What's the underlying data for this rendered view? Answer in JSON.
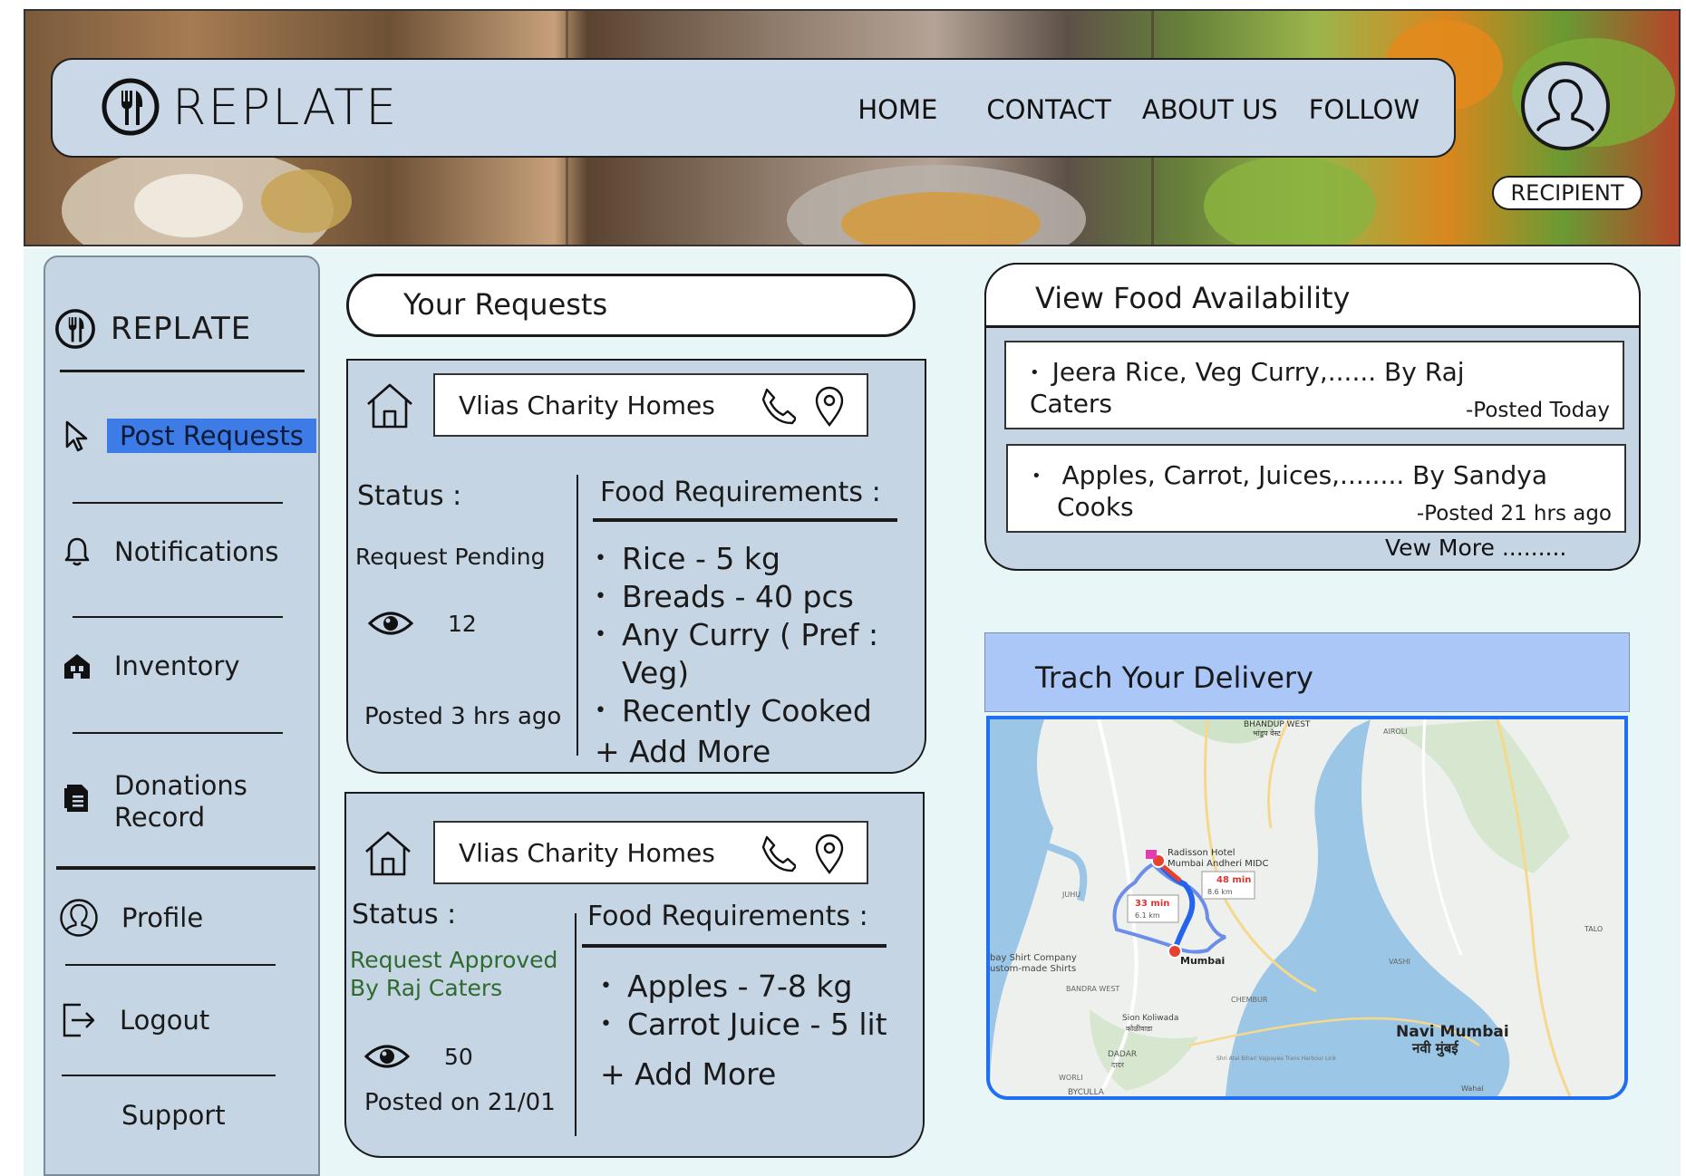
{
  "brand": {
    "name": "REPLATE"
  },
  "nav": {
    "home": "HOME",
    "contact": "CONTACT",
    "about": "ABOUT US",
    "follow": "FOLLOW"
  },
  "user": {
    "role": "RECIPIENT"
  },
  "sidebar": {
    "brand": "REPLATE",
    "items": [
      {
        "label": "Post Requests",
        "icon": "cursor-icon",
        "active": true
      },
      {
        "label": "Notifications",
        "icon": "bell-icon"
      },
      {
        "label": "Inventory",
        "icon": "store-icon"
      },
      {
        "label": "Donations",
        "label2": "Record",
        "icon": "document-icon"
      },
      {
        "label": "Profile",
        "icon": "user-circle-icon"
      },
      {
        "label": "Logout",
        "icon": "logout-icon"
      },
      {
        "label": "Support"
      }
    ]
  },
  "requests": {
    "title": "Your Requests",
    "cards": [
      {
        "org": "Vlias Charity Homes",
        "status_label": "Status :",
        "status": "Request Pending",
        "status_color": "#1a1a1a",
        "views": "12",
        "posted": "Posted 3 hrs ago",
        "food_title": "Food Requirements :",
        "items": [
          "Rice -  5 kg",
          "Breads - 40 pcs",
          "Any Curry ( Pref : Veg)",
          "Recently Cooked"
        ],
        "add_more": "+ Add More"
      },
      {
        "org": "Vlias Charity Homes",
        "status_label": "Status :",
        "status": "Request Approved",
        "status2": "By Raj Caters",
        "status_color": "#2f6b2f",
        "views": "50",
        "posted": "Posted on 21/01",
        "food_title": "Food Requirements :",
        "items": [
          "Apples - 7-8 kg",
          "Carrot Juice - 5 lit"
        ],
        "add_more": "+ Add More"
      }
    ]
  },
  "availability": {
    "title": "View Food Availability",
    "items": [
      {
        "text": "Jeera Rice, Veg Curry,...... By Raj Caters",
        "posted": "-Posted  Today"
      },
      {
        "text": "Apples, Carrot, Juices,........  By Sandya",
        "text2": "Cooks",
        "posted": "-Posted  21 hrs ago"
      }
    ],
    "view_more": "Vew More ........."
  },
  "delivery": {
    "title": "Trach Your Delivery",
    "map": {
      "labels": {
        "bhandup": "BHANDUP WEST",
        "bhandup_local": "भांडुप वेस्ट",
        "hotel1": "Radisson Hotel",
        "hotel2": "Mumbai Andheri MIDC",
        "route1_time": "33 min",
        "route1_dist": "6.1 km",
        "route2_time": "48 min",
        "route2_dist": "8.6 km",
        "mumbai": "Mumbai",
        "shirt1": "bay Shirt Company",
        "shirt2": "ustom-made Shirts",
        "bandra": "BANDRA WEST",
        "sion": "Sion Koliwada",
        "sion_local": "कोळीवाडा",
        "chembur": "CHEMBUR",
        "vashi": "VASHI",
        "navi1": "Navi Mumbai",
        "navi2": "नवी मुंबई",
        "dadar": "DADAR",
        "dadar_local": "दादर",
        "worli": "WORLI",
        "byculla": "BYCULLA",
        "talo": "TALO",
        "wadi": "Wahal",
        "airoli": "AIROLI",
        "juhu": "JUHU",
        "bridge": "Shri Atal Bihari Vajpayee Trans Harbour Link"
      },
      "colors": {
        "route": "#2563eb",
        "route_alt": "#3a5bd9",
        "pin": "#e8422f",
        "water": "#9cc6e6",
        "land": "#eef0ed"
      }
    }
  }
}
